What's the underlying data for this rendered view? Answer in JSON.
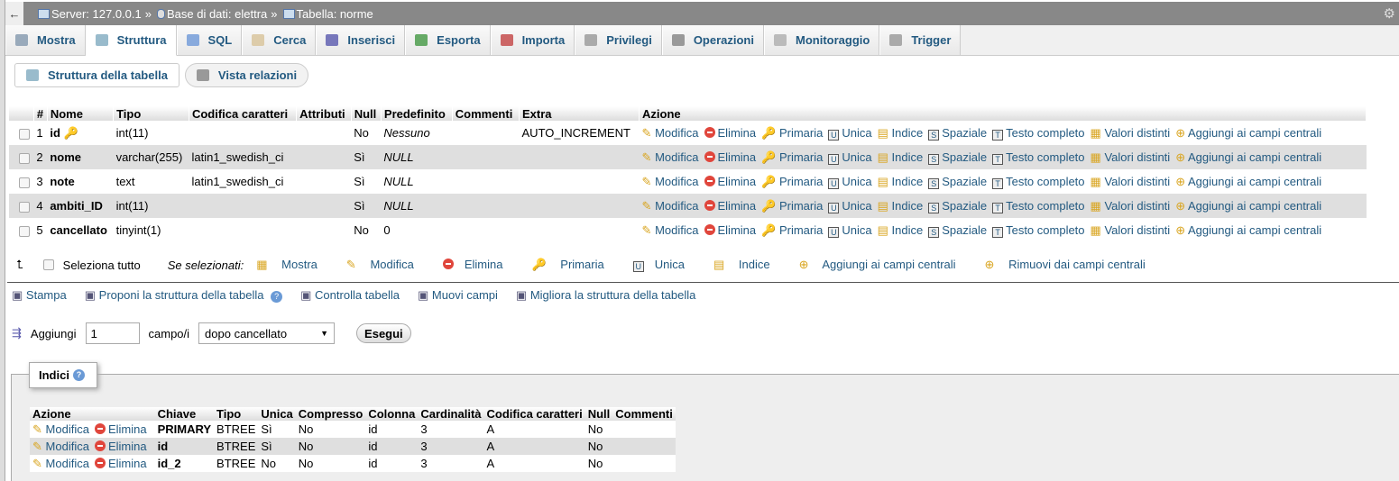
{
  "breadcrumb": {
    "server": "Server: 127.0.0.1",
    "database": "Base di dati: elettra",
    "table": "Tabella: norme",
    "sep": "»",
    "back": "←"
  },
  "tabs": [
    {
      "label": "Mostra",
      "icon": "browse-icon"
    },
    {
      "label": "Struttura",
      "icon": "structure-icon",
      "active": true
    },
    {
      "label": "SQL",
      "icon": "sql-icon"
    },
    {
      "label": "Cerca",
      "icon": "search-icon"
    },
    {
      "label": "Inserisci",
      "icon": "insert-icon"
    },
    {
      "label": "Esporta",
      "icon": "export-icon"
    },
    {
      "label": "Importa",
      "icon": "import-icon"
    },
    {
      "label": "Privilegi",
      "icon": "privileges-icon"
    },
    {
      "label": "Operazioni",
      "icon": "operations-icon"
    },
    {
      "label": "Monitoraggio",
      "icon": "tracking-icon"
    },
    {
      "label": "Trigger",
      "icon": "trigger-icon"
    }
  ],
  "subnav": {
    "structure": "Struttura della tabella",
    "relations": "Vista relazioni"
  },
  "structure": {
    "headers": [
      "#",
      "Nome",
      "Tipo",
      "Codifica caratteri",
      "Attributi",
      "Null",
      "Predefinito",
      "Commenti",
      "Extra",
      "Azione"
    ],
    "rows": [
      {
        "n": "1",
        "name": "id",
        "type": "int(11)",
        "collation": "",
        "attr": "",
        "null": "No",
        "default": "Nessuno",
        "comments": "",
        "extra": "AUTO_INCREMENT"
      },
      {
        "n": "2",
        "name": "nome",
        "type": "varchar(255)",
        "collation": "latin1_swedish_ci",
        "attr": "",
        "null": "Sì",
        "default": "NULL",
        "comments": "",
        "extra": ""
      },
      {
        "n": "3",
        "name": "note",
        "type": "text",
        "collation": "latin1_swedish_ci",
        "attr": "",
        "null": "Sì",
        "default": "NULL",
        "comments": "",
        "extra": ""
      },
      {
        "n": "4",
        "name": "ambiti_ID",
        "type": "int(11)",
        "collation": "",
        "attr": "",
        "null": "Sì",
        "default": "NULL",
        "comments": "",
        "extra": ""
      },
      {
        "n": "5",
        "name": "cancellato",
        "type": "tinyint(1)",
        "collation": "",
        "attr": "",
        "null": "No",
        "default": "0",
        "comments": "",
        "extra": ""
      }
    ],
    "actions": [
      "Modifica",
      "Elimina",
      "Primaria",
      "Unica",
      "Indice",
      "Spaziale",
      "Testo completo",
      "Valori distinti",
      "Aggiungi ai campi centrali"
    ]
  },
  "bulk": {
    "select_all": "Seleziona tutto",
    "with_selected": "Se selezionati:",
    "actions": [
      "Mostra",
      "Modifica",
      "Elimina",
      "Primaria",
      "Unica",
      "Indice",
      "Aggiungi ai campi centrali",
      "Rimuovi dai campi centrali"
    ]
  },
  "links": [
    "Stampa",
    "Proponi la struttura della tabella",
    "Controlla tabella",
    "Muovi campi",
    "Migliora la struttura della tabella"
  ],
  "add": {
    "label": "Aggiungi",
    "value": "1",
    "unit": "campo/i",
    "position": "dopo cancellato",
    "go": "Esegui"
  },
  "indexes": {
    "legend": "Indici",
    "headers": [
      "Azione",
      "Chiave",
      "Tipo",
      "Unica",
      "Compresso",
      "Colonna",
      "Cardinalità",
      "Codifica caratteri",
      "Null",
      "Commenti"
    ],
    "edit": "Modifica",
    "drop": "Elimina",
    "rows": [
      {
        "key": "PRIMARY",
        "type": "BTREE",
        "unique": "Sì",
        "packed": "No",
        "column": "id",
        "cardinality": "3",
        "collation": "A",
        "null": "No",
        "comment": ""
      },
      {
        "key": "id",
        "type": "BTREE",
        "unique": "Sì",
        "packed": "No",
        "column": "id",
        "cardinality": "3",
        "collation": "A",
        "null": "No",
        "comment": ""
      },
      {
        "key": "id_2",
        "type": "BTREE",
        "unique": "No",
        "packed": "No",
        "column": "id",
        "cardinality": "3",
        "collation": "A",
        "null": "No",
        "comment": ""
      }
    ]
  }
}
